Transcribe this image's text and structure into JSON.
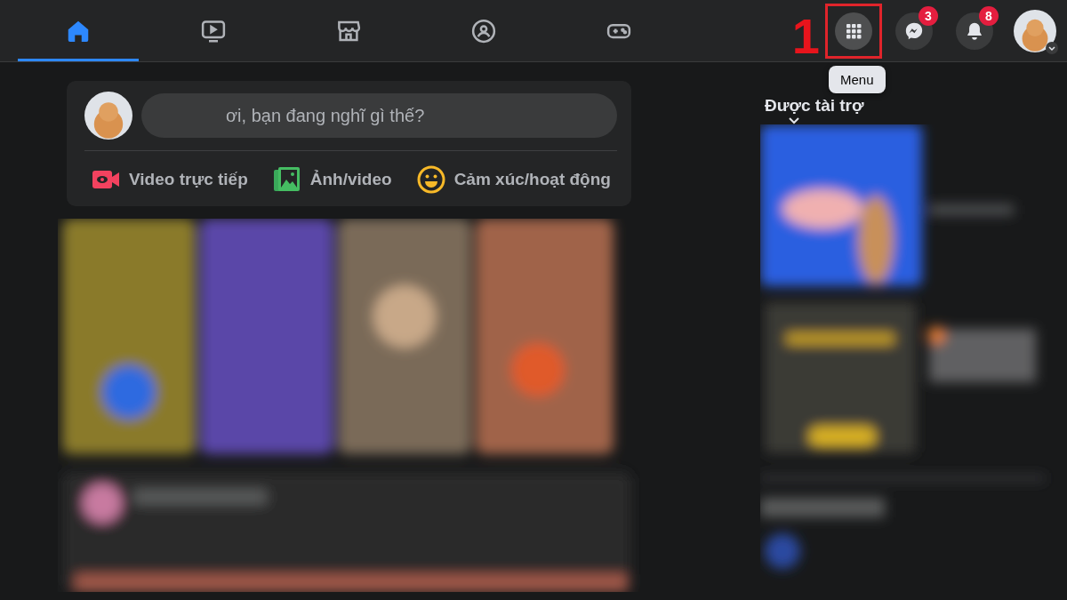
{
  "top_bar": {
    "tabs": [
      {
        "kind": "home",
        "selected": true
      },
      {
        "kind": "watch",
        "selected": false
      },
      {
        "kind": "marketplace",
        "selected": false
      },
      {
        "kind": "groups",
        "selected": false
      },
      {
        "kind": "gaming",
        "selected": false
      }
    ],
    "annotation": "1",
    "actions": [
      {
        "kind": "menu",
        "highlighted": true
      },
      {
        "kind": "messenger",
        "badge": "3",
        "highlighted": false
      },
      {
        "kind": "notifications",
        "badge": "8",
        "highlighted": false
      }
    ],
    "tooltip": "Menu"
  },
  "composer": {
    "placeholder": "ơi, bạn đang nghĩ gì thế?",
    "actions": [
      {
        "kind": "live",
        "label": "Video trực tiếp"
      },
      {
        "label": "Ảnh/video"
      },
      {
        "kind": "feeling",
        "label": "Cảm xúc/hoạt động"
      }
    ]
  },
  "sponsored": {
    "title": "Được tài trợ"
  }
}
